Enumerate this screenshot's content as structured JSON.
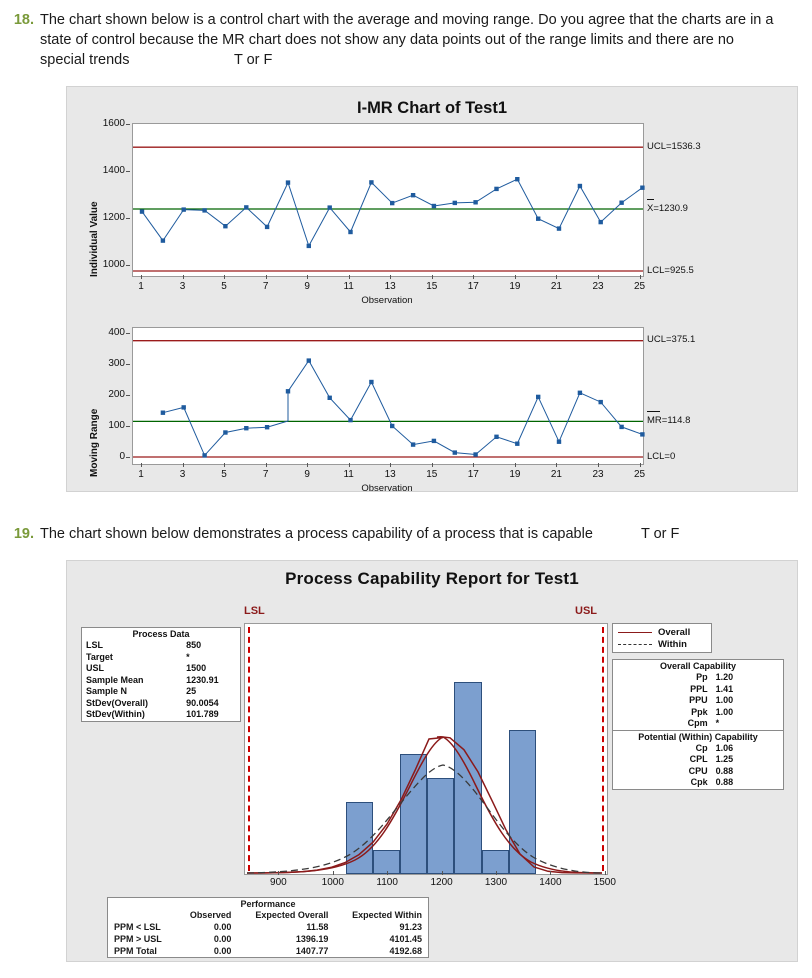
{
  "questions": [
    {
      "number": "18.",
      "lines": [
        "The chart shown below is a control chart with the average and moving range. Do you agree that the charts are in a",
        "state of control because the MR chart does not show any data points out of the range limits and there are no",
        "special trends                          T or F"
      ]
    },
    {
      "number": "19.",
      "lines": [
        "The chart shown below demonstrates a process capability of a process that is capable            T or F"
      ]
    }
  ],
  "imr": {
    "title": "I-MR Chart of Test1",
    "individuals": {
      "ylabel": "Individual Value",
      "xlabel": "Observation",
      "yticks": [
        "1000",
        "1200",
        "1400",
        "1600"
      ],
      "xticks": [
        "1",
        "3",
        "5",
        "7",
        "9",
        "11",
        "13",
        "15",
        "17",
        "19",
        "21",
        "23",
        "25"
      ],
      "ucl_label": "UCL=1536.3",
      "center_label": "X=1230.9",
      "lcl_label": "LCL=925.5"
    },
    "moving_range": {
      "ylabel": "Moving Range",
      "xlabel": "Observation",
      "yticks": [
        "0",
        "100",
        "200",
        "300",
        "400"
      ],
      "xticks": [
        "1",
        "3",
        "5",
        "7",
        "9",
        "11",
        "13",
        "15",
        "17",
        "19",
        "21",
        "23",
        "25"
      ],
      "ucl_label": "UCL=375.1",
      "center_label": "MR=114.8",
      "lcl_label": "LCL=0"
    }
  },
  "capability": {
    "title": "Process Capability Report for Test1",
    "process_data": {
      "header": "Process Data",
      "rows": [
        {
          "label": "LSL",
          "value": "850"
        },
        {
          "label": "Target",
          "value": "*"
        },
        {
          "label": "USL",
          "value": "1500"
        },
        {
          "label": "Sample Mean",
          "value": "1230.91"
        },
        {
          "label": "Sample N",
          "value": "25"
        },
        {
          "label": "StDev(Overall)",
          "value": "90.0054"
        },
        {
          "label": "StDev(Within)",
          "value": "101.789"
        }
      ]
    },
    "legend": {
      "overall": "Overall",
      "within": "Within"
    },
    "overall_capability": {
      "header": "Overall Capability",
      "rows": [
        {
          "label": "Pp",
          "value": "1.20"
        },
        {
          "label": "PPL",
          "value": "1.41"
        },
        {
          "label": "PPU",
          "value": "1.00"
        },
        {
          "label": "Ppk",
          "value": "1.00"
        },
        {
          "label": "Cpm",
          "value": "*"
        }
      ]
    },
    "within_capability": {
      "header": "Potential (Within) Capability",
      "rows": [
        {
          "label": "Cp",
          "value": "1.06"
        },
        {
          "label": "CPL",
          "value": "1.25"
        },
        {
          "label": "CPU",
          "value": "0.88"
        },
        {
          "label": "Cpk",
          "value": "0.88"
        }
      ]
    },
    "performance": {
      "header": "Performance",
      "columns": [
        "",
        "Observed",
        "Expected Overall",
        "Expected Within"
      ],
      "rows": [
        {
          "label": "PPM < LSL",
          "observed": "0.00",
          "expected_overall": "11.58",
          "expected_within": "91.23"
        },
        {
          "label": "PPM > USL",
          "observed": "0.00",
          "expected_overall": "1396.19",
          "expected_within": "4101.45"
        },
        {
          "label": "PPM Total",
          "observed": "0.00",
          "expected_overall": "1407.77",
          "expected_within": "4192.68"
        }
      ]
    },
    "lsl_label": "LSL",
    "usl_label": "USL"
  },
  "colors": {
    "question_number": "#7a9a3a",
    "panel_background": "#e8e8e8",
    "control_limit": "#9b1b1b",
    "center_line": "#006400",
    "series": "#1f5b9e",
    "histogram_bar": "#7c9fcf",
    "spec_limit": "#cc0000"
  },
  "chart_data": [
    {
      "type": "line",
      "title": "I-MR Chart of Test1 — Individuals",
      "xlabel": "Observation",
      "ylabel": "Individual Value",
      "xlim": [
        1,
        25
      ],
      "ylim": [
        900,
        1650
      ],
      "yticks": [
        1000,
        1200,
        1400,
        1600
      ],
      "xticks": [
        1,
        3,
        5,
        7,
        9,
        11,
        13,
        15,
        17,
        19,
        21,
        23,
        25
      ],
      "grid": false,
      "legend": "right-annotations",
      "x": [
        1,
        2,
        3,
        4,
        5,
        6,
        7,
        8,
        9,
        10,
        11,
        12,
        13,
        14,
        15,
        16,
        17,
        18,
        19,
        20,
        21,
        22,
        23,
        24,
        25
      ],
      "series": [
        {
          "name": "Individual Value",
          "values": [
            1218,
            1075,
            1228,
            1224,
            1146,
            1239,
            1142,
            1360,
            1048,
            1238,
            1118,
            1359,
            1257,
            1296,
            1243,
            1258,
            1261,
            1327,
            1375,
            1180,
            1131,
            1341,
            1163,
            1259,
            1333
          ]
        }
      ],
      "reference_lines": [
        {
          "label": "UCL=1536.3",
          "value": 1536.3,
          "color": "#9b1b1b"
        },
        {
          "label": "X=1230.9",
          "value": 1230.9,
          "color": "#006400"
        },
        {
          "label": "LCL=925.5",
          "value": 925.5,
          "color": "#9b1b1b"
        }
      ]
    },
    {
      "type": "line",
      "title": "I-MR Chart of Test1 — Moving Range",
      "xlabel": "Observation",
      "ylabel": "Moving Range",
      "xlim": [
        1,
        25
      ],
      "ylim": [
        -15,
        415
      ],
      "yticks": [
        0,
        100,
        200,
        300,
        400
      ],
      "xticks": [
        1,
        3,
        5,
        7,
        9,
        11,
        13,
        15,
        17,
        19,
        21,
        23,
        25
      ],
      "grid": false,
      "legend": "right-annotations",
      "x": [
        2,
        3,
        4,
        5,
        6,
        7,
        8,
        9,
        10,
        11,
        12,
        13,
        14,
        15,
        16,
        17,
        18,
        19,
        20,
        21,
        22,
        23,
        24,
        25
      ],
      "series": [
        {
          "name": "Moving Range",
          "values": [
            143,
            160,
            5,
            79,
            93,
            96,
            212,
            311,
            191,
            119,
            242,
            100,
            40,
            52,
            14,
            8,
            65,
            43,
            194,
            48,
            207,
            177,
            97,
            73
          ]
        }
      ],
      "reference_lines": [
        {
          "label": "UCL=375.1",
          "value": 375.1,
          "color": "#9b1b1b"
        },
        {
          "label": "MR=114.8",
          "value": 114.8,
          "color": "#006400"
        },
        {
          "label": "LCL=0",
          "value": 0,
          "color": "#9b1b1b"
        }
      ]
    },
    {
      "type": "bar",
      "title": "Process Capability Report for Test1 — Histogram",
      "xlabel": "",
      "ylabel": "",
      "xlim": [
        845,
        1510
      ],
      "xticks": [
        900,
        1000,
        1100,
        1200,
        1300,
        1400,
        1500
      ],
      "grid": false,
      "bin_edges": [
        1030,
        1080,
        1130,
        1180,
        1230,
        1280,
        1330,
        1380
      ],
      "categories": [
        "1030-1080",
        "1080-1130",
        "1130-1180",
        "1180-1230",
        "1230-1280",
        "1280-1330",
        "1330-1380"
      ],
      "values": [
        3,
        1,
        5,
        4,
        8,
        1,
        6
      ],
      "ylim": [
        0,
        8
      ],
      "spec_lines": [
        {
          "label": "LSL",
          "value": 850,
          "color": "#cc0000"
        },
        {
          "label": "USL",
          "value": 1500,
          "color": "#cc0000"
        }
      ],
      "curves": [
        {
          "name": "Overall",
          "style": "solid",
          "color": "#8b1a1a",
          "mean": 1230.91,
          "sd": 90.0054
        },
        {
          "name": "Within",
          "style": "dashed",
          "color": "#333333",
          "mean": 1230.91,
          "sd": 101.789
        }
      ]
    }
  ]
}
